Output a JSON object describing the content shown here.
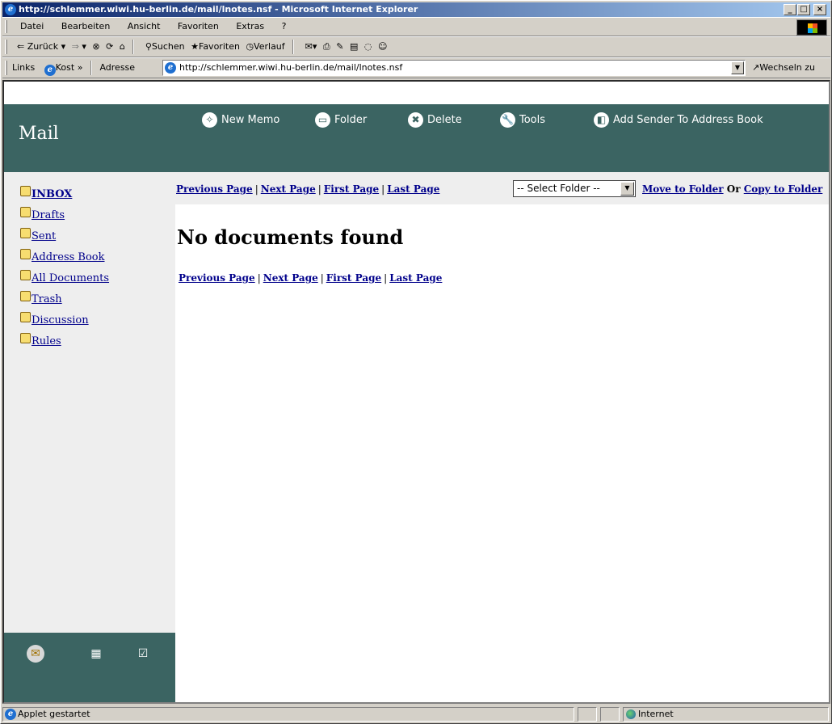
{
  "window": {
    "title": "http://schlemmer.wiwi.hu-berlin.de/mail/lnotes.nsf - Microsoft Internet Explorer"
  },
  "menu": [
    "Datei",
    "Bearbeiten",
    "Ansicht",
    "Favoriten",
    "Extras",
    "?"
  ],
  "toolbar": {
    "back": "Zurück",
    "search": "Suchen",
    "favorites": "Favoriten",
    "history": "Verlauf"
  },
  "addressbar": {
    "links": "Links",
    "kost": "Kost",
    "links_more": "»",
    "address_label": "Adresse",
    "url": "http://schlemmer.wiwi.hu-berlin.de/mail/lnotes.nsf",
    "go": "Wechseln zu"
  },
  "app": {
    "title": "Mail",
    "actions": [
      {
        "label": "New Memo",
        "icon": "new-memo-icon"
      },
      {
        "label": "Folder",
        "icon": "folder-icon"
      },
      {
        "label": "Delete",
        "icon": "delete-icon"
      },
      {
        "label": "Tools",
        "icon": "tools-icon"
      },
      {
        "label": "Add Sender To Address Book",
        "icon": "address-book-icon"
      }
    ],
    "nav": [
      {
        "label": "INBOX",
        "active": true
      },
      {
        "label": "Drafts"
      },
      {
        "label": "Sent"
      },
      {
        "label": "Address Book"
      },
      {
        "label": "All Documents"
      },
      {
        "label": "Trash"
      },
      {
        "label": "Discussion"
      },
      {
        "label": "Rules"
      }
    ],
    "pager": {
      "previous": "Previous Page",
      "next": "Next Page",
      "first": "First Page",
      "last": "Last Page",
      "sep": "|"
    },
    "folder_select": {
      "value": "-- Select Folder --"
    },
    "move": {
      "move_label": "Move to Folder",
      "or": "Or",
      "copy_label": "Copy to Folder"
    },
    "message": "No documents found"
  },
  "status": {
    "text": "Applet gestartet",
    "zone": "Internet"
  },
  "colors": {
    "header_bg": "#3b6462",
    "sidebar_bg": "#eeeeee",
    "link": "#00008b"
  }
}
